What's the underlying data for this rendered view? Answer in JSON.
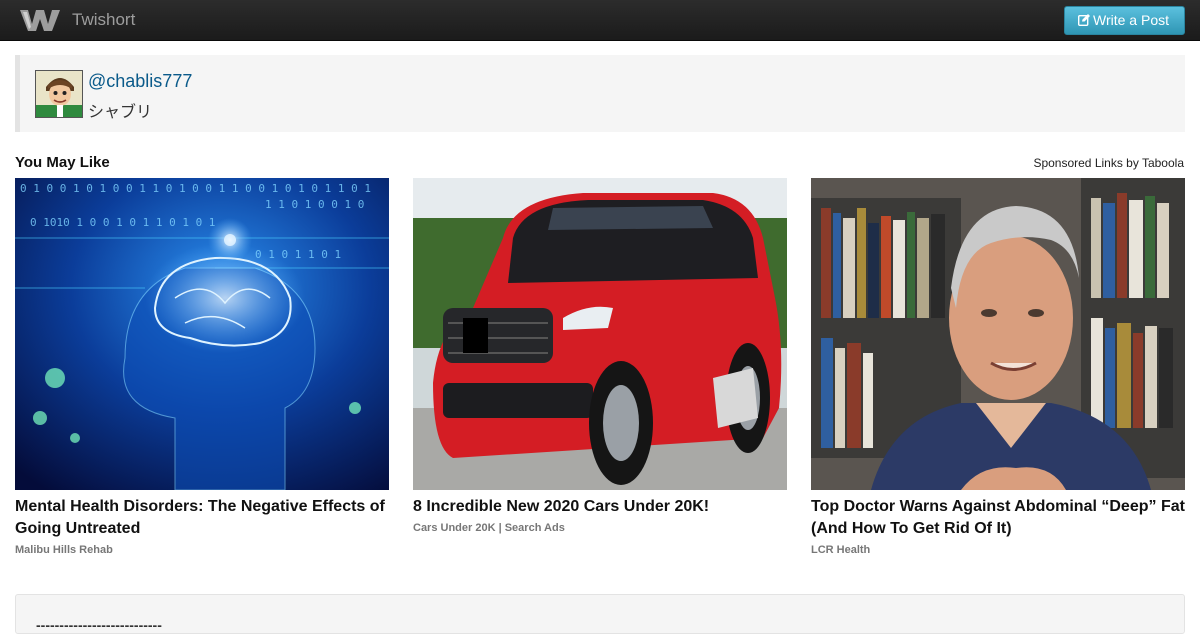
{
  "navbar": {
    "brand_name": "Twishort",
    "write_button_label": "Write a Post",
    "write_button_icon": "edit-icon",
    "logo_icon": "twishort-logo-icon"
  },
  "profile": {
    "username": "@chablis777",
    "display_name": "シャブリ"
  },
  "widget": {
    "title": "You May Like",
    "sponsored_label": "Sponsored Links by Taboola",
    "cards": [
      {
        "headline": "Mental Health Disorders: The Negative Effects of Going Untreated",
        "source": "Malibu Hills Rehab",
        "image": "brain-digital-illustration"
      },
      {
        "headline": "8 Incredible New 2020 Cars Under 20K!",
        "source": "Cars Under 20K | Search Ads",
        "image": "red-suv-photo"
      },
      {
        "headline": "Top Doctor Warns Against Abdominal “Deep” Fat (And How To Get Rid Of It)",
        "source": "LCR Health",
        "image": "doctor-portrait-photo"
      }
    ]
  },
  "content": {
    "separator": "---------------------------"
  },
  "colors": {
    "navbar_bg": "#1b1b1b",
    "button_primary": "#2f96b4",
    "link": "#0a5a8a",
    "card_bg": "#f5f5f5"
  }
}
